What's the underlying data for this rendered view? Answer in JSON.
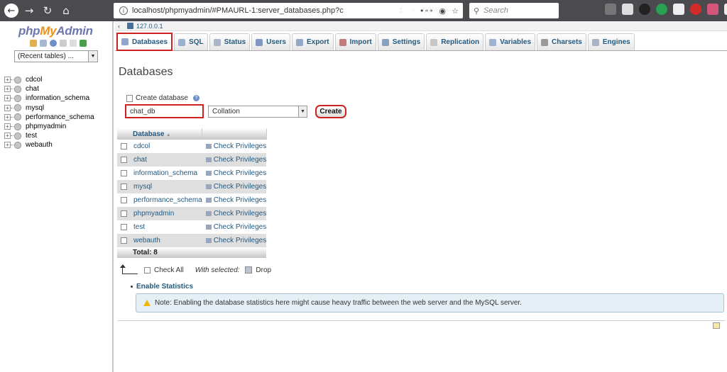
{
  "browser": {
    "url": "localhost/phpmyadmin/#PMAURL-1:server_databases.php?c",
    "zoom": "90%",
    "search_placeholder": "Search",
    "more_glyph": "•••"
  },
  "sidebar": {
    "logo": {
      "php": "php",
      "my": "My",
      "admin": "Admin"
    },
    "recent_tables": "(Recent tables) ...",
    "databases": [
      "cdcol",
      "chat",
      "information_schema",
      "mysql",
      "performance_schema",
      "phpmyadmin",
      "test",
      "webauth"
    ]
  },
  "server": {
    "name": "127.0.0.1"
  },
  "tabs": [
    {
      "label": "Databases",
      "icon": "database-icon",
      "color": "#8fa5c9"
    },
    {
      "label": "SQL",
      "icon": "sql-icon",
      "color": "#9ab0d0"
    },
    {
      "label": "Status",
      "icon": "status-icon",
      "color": "#a9b7c9"
    },
    {
      "label": "Users",
      "icon": "users-icon",
      "color": "#7f97c3"
    },
    {
      "label": "Export",
      "icon": "export-icon",
      "color": "#94a9c8"
    },
    {
      "label": "Import",
      "icon": "import-icon",
      "color": "#c27a7a"
    },
    {
      "label": "Settings",
      "icon": "settings-icon",
      "color": "#8aa0bf"
    },
    {
      "label": "Replication",
      "icon": "replication-icon",
      "color": "#c7c7c7"
    },
    {
      "label": "Variables",
      "icon": "variables-icon",
      "color": "#9fb2cf"
    },
    {
      "label": "Charsets",
      "icon": "charsets-icon",
      "color": "#9a9a9a"
    },
    {
      "label": "Engines",
      "icon": "engines-icon",
      "color": "#a7b4c6"
    }
  ],
  "main": {
    "title": "Databases",
    "create_label": "Create database",
    "help_glyph": "?",
    "db_name_value": "chat_db",
    "collation_placeholder": "Collation",
    "create_button": "Create",
    "table": {
      "header_database": "Database",
      "sort_glyph": "▲",
      "rows": [
        {
          "name": "cdcol",
          "action": "Check Privileges"
        },
        {
          "name": "chat",
          "action": "Check Privileges"
        },
        {
          "name": "information_schema",
          "action": "Check Privileges"
        },
        {
          "name": "mysql",
          "action": "Check Privileges"
        },
        {
          "name": "performance_schema",
          "action": "Check Privileges"
        },
        {
          "name": "phpmyadmin",
          "action": "Check Privileges"
        },
        {
          "name": "test",
          "action": "Check Privileges"
        },
        {
          "name": "webauth",
          "action": "Check Privileges"
        }
      ],
      "total": "Total: 8"
    },
    "check_all": "Check All",
    "with_selected": "With selected:",
    "drop": "Drop",
    "enable_statistics": "Enable Statistics",
    "notice": "Note: Enabling the database statistics here might cause heavy traffic between the web server and the MySQL server."
  }
}
